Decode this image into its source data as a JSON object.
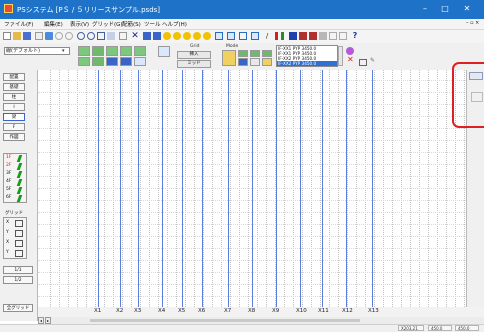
{
  "window": {
    "title": "PSシステム [PＳ / ５リリースサンプル.psds]",
    "min": "–",
    "max": "□",
    "close": "✕"
  },
  "menubar": {
    "items": [
      "ファイル(F)",
      "編集(E)",
      "表示(V)",
      "グリッド(G)",
      "配筋(S)",
      "ツール",
      "ヘルプ(H)"
    ]
  },
  "toolbar2": {
    "view_combo": "線(デフォルト)",
    "group_label_1": "Grid",
    "btn_label_1": "挿入",
    "btn_label_2": "ミッド",
    "group_label_2": "Mode",
    "list_lines": [
      "IF-XX1  PYP  3450.0",
      "IF-XX1  PYP  3450.0",
      "IF-XX2  PYP  3450.0",
      "IF-XX2  PYP  3450.0"
    ]
  },
  "sidebar": {
    "buttons": [
      "配置",
      "基礎",
      "柱",
      "I",
      "梁",
      "F",
      "作図"
    ],
    "group2": [
      "1F",
      "2F",
      "3F",
      "4F",
      "5F",
      "6F"
    ],
    "group3_title": "グリッド",
    "group3": [
      "X",
      "Y",
      "X",
      "Y"
    ],
    "group4": [
      "1/1",
      "1/2"
    ],
    "bottom": "全グリッド"
  },
  "axis": {
    "labels": [
      "X1",
      "X2",
      "X3",
      "X4",
      "X5",
      "X6",
      "X7",
      "X8",
      "X9",
      "X10",
      "X11",
      "X12",
      "X13"
    ]
  },
  "status": {
    "fields": [
      "X203,21",
      "450.0",
      "450.0"
    ]
  },
  "colors": {
    "titlebar": "#1e73c9",
    "highlight_red": "#e02020",
    "grid_blue": "#5b7fe0"
  }
}
